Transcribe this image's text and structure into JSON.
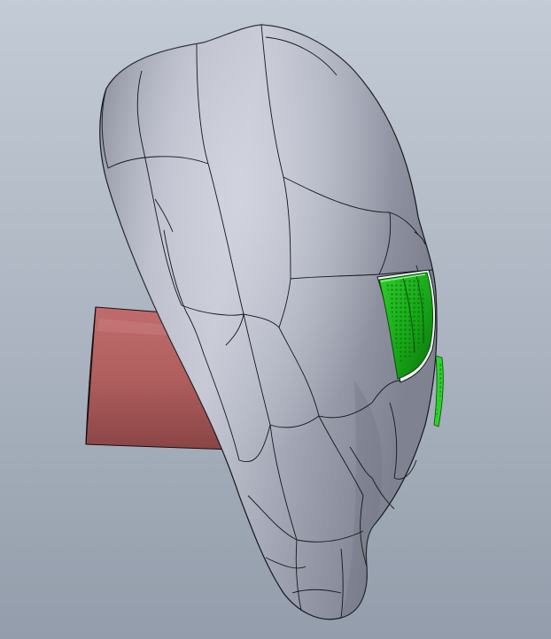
{
  "scene": {
    "background_top": "#bcc5d1",
    "background_bottom": "#959fac",
    "body_color": "#a9adbb",
    "body_highlight": "#c7cad6",
    "body_shadow": "#7e8290",
    "edge_color": "#101218",
    "cylinder_color": "#b05c5c",
    "cylinder_light": "#c57474",
    "cylinder_dark": "#7e3c3c",
    "selected_face_color": "#1bb31b",
    "selected_face_dark": "#0c7a0c",
    "selected_face_light": "#5fe05f"
  }
}
